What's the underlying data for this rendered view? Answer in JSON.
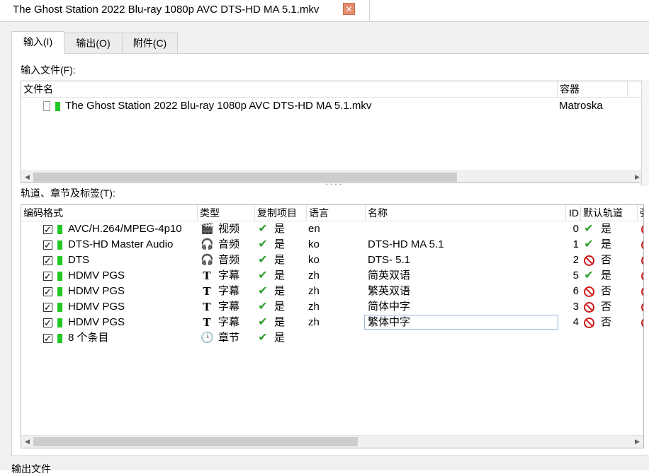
{
  "window": {
    "tab_title": "The Ghost Station 2022 Blu-ray 1080p AVC DTS-HD MA 5.1.mkv",
    "close_glyph": "✕"
  },
  "tabs": [
    {
      "label": "输入(I)"
    },
    {
      "label": "输出(O)"
    },
    {
      "label": "附件(C)"
    }
  ],
  "input_files": {
    "section_label": "输入文件(F):",
    "columns": {
      "filename": "文件名",
      "container": "容器"
    },
    "rows": [
      {
        "filename": "The Ghost Station 2022 Blu-ray 1080p AVC DTS-HD MA 5.1.mkv",
        "container": "Matroska"
      }
    ]
  },
  "tracks": {
    "section_label": "轨道、章节及标签(T):",
    "columns": {
      "codec": "编码格式",
      "type": "类型",
      "copy": "复制项目",
      "language": "语言",
      "name": "名称",
      "id": "ID",
      "default": "默认轨道",
      "forced": "强"
    },
    "rows": [
      {
        "codec": "AVC/H.264/MPEG-4p10",
        "type_icon": "clapperboard-icon",
        "type": "视频",
        "copy": "是",
        "language": "en",
        "name": "",
        "id": "0",
        "default_icon": "check-icon",
        "default": "是"
      },
      {
        "codec": "DTS-HD Master Audio",
        "type_icon": "headphones-icon",
        "type": "音频",
        "copy": "是",
        "language": "ko",
        "name": "DTS-HD MA 5.1",
        "id": "1",
        "default_icon": "check-icon",
        "default": "是"
      },
      {
        "codec": "DTS",
        "type_icon": "headphones-icon",
        "type": "音频",
        "copy": "是",
        "language": "ko",
        "name": "DTS- 5.1",
        "id": "2",
        "default_icon": "no-icon",
        "default": "否"
      },
      {
        "codec": "HDMV PGS",
        "type_icon": "text-icon",
        "type": "字幕",
        "copy": "是",
        "language": "zh",
        "name": "简英双语",
        "id": "5",
        "default_icon": "check-icon",
        "default": "是"
      },
      {
        "codec": "HDMV PGS",
        "type_icon": "text-icon",
        "type": "字幕",
        "copy": "是",
        "language": "zh",
        "name": "繁英双语",
        "id": "6",
        "default_icon": "no-icon",
        "default": "否"
      },
      {
        "codec": "HDMV PGS",
        "type_icon": "text-icon",
        "type": "字幕",
        "copy": "是",
        "language": "zh",
        "name": "简体中字",
        "id": "3",
        "default_icon": "no-icon",
        "default": "否"
      },
      {
        "codec": "HDMV PGS",
        "type_icon": "text-icon",
        "type": "字幕",
        "copy": "是",
        "language": "zh",
        "name": "繁体中字",
        "id": "4",
        "default_icon": "no-icon",
        "default": "否"
      },
      {
        "codec": "8 个条目",
        "type_icon": "clock-icon",
        "type": "章节",
        "copy": "是",
        "language": "",
        "name": "",
        "id": "",
        "default_icon": "",
        "default": ""
      }
    ]
  },
  "output_section_label": "输出文件"
}
